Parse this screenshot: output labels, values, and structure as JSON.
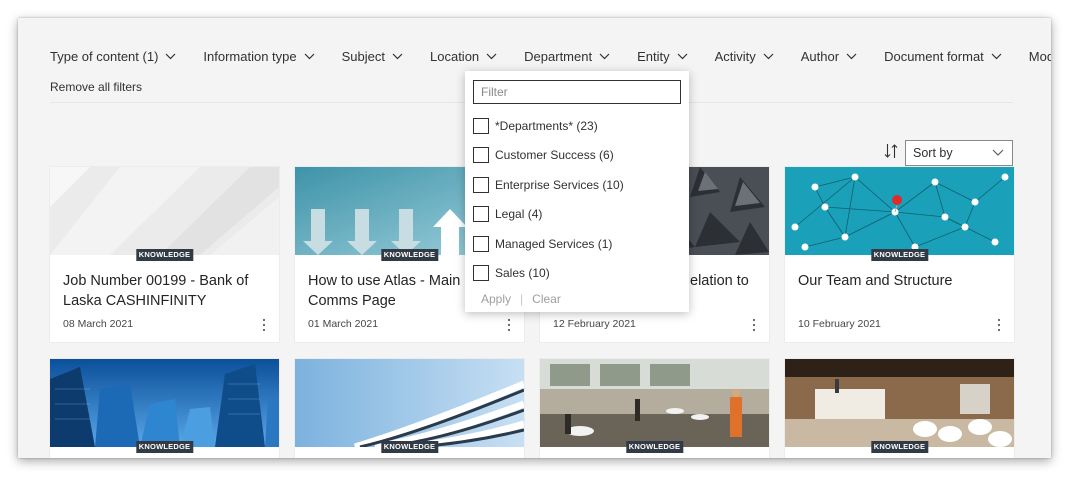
{
  "filters": [
    {
      "label": "Type of content (1)"
    },
    {
      "label": "Information type"
    },
    {
      "label": "Subject"
    },
    {
      "label": "Location"
    },
    {
      "label": "Department"
    },
    {
      "label": "Entity"
    },
    {
      "label": "Activity"
    },
    {
      "label": "Author"
    },
    {
      "label": "Document format"
    },
    {
      "label": "Modified"
    }
  ],
  "remove_all_label": "Remove all filters",
  "sort": {
    "label": "Sort by",
    "icon": "sort-order-icon"
  },
  "dropdown": {
    "filter_placeholder": "Filter",
    "options": [
      {
        "label": "*Departments* (23)",
        "checked": false
      },
      {
        "label": "Customer Success (6)",
        "checked": false
      },
      {
        "label": "Enterprise Services (10)",
        "checked": false
      },
      {
        "label": "Legal (4)",
        "checked": false
      },
      {
        "label": "Managed Services (1)",
        "checked": false
      },
      {
        "label": "Sales (10)",
        "checked": false
      }
    ],
    "apply_label": "Apply",
    "separator": "|",
    "clear_label": "Clear"
  },
  "cards": [
    {
      "badge": "KNOWLEDGE",
      "title": "Job Number 00199 - Bank of Laska CASHINFINITY",
      "date": "08 March 2021"
    },
    {
      "badge": "KNOWLEDGE",
      "title": "How to use Atlas - Main Comms Page",
      "date": "01 March 2021"
    },
    {
      "badge": "KNOWLEDGE",
      "title": "elation to",
      "date": "12 February 2021"
    },
    {
      "badge": "KNOWLEDGE",
      "title": "Our Team and Structure",
      "date": "10 February 2021"
    },
    {
      "badge": "KNOWLEDGE"
    },
    {
      "badge": "KNOWLEDGE"
    },
    {
      "badge": "KNOWLEDGE"
    },
    {
      "badge": "KNOWLEDGE"
    }
  ],
  "colors": {
    "badge_bg": "#323a45",
    "accent_pin": "#e02b2b",
    "map_bg": "#1aa0b8"
  }
}
